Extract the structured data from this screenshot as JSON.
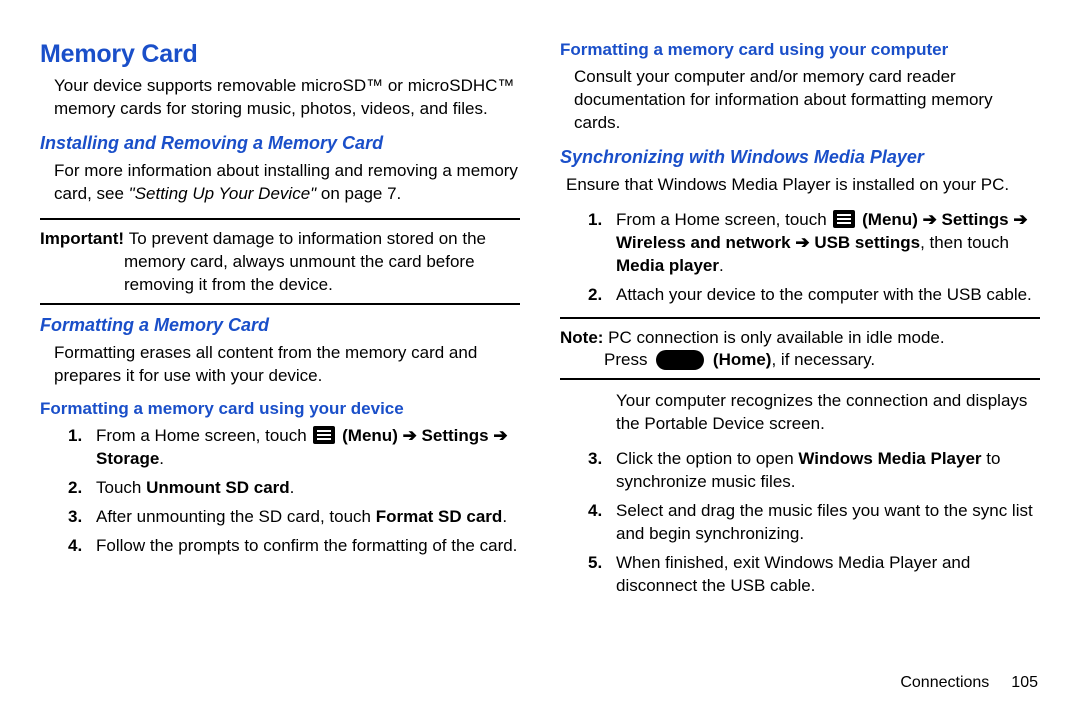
{
  "mainHeading": "Memory Card",
  "intro": "Your device supports removable microSD™ or microSDHC™ memory cards for storing music, photos, videos, and files.",
  "installHeading": "Installing and Removing a Memory Card",
  "installText1": "For more information about installing and removing a memory card, see ",
  "installRef": "\"Setting Up Your Device\"",
  "installText2": " on page 7.",
  "importantLabel": "Important! ",
  "importantText": "To prevent damage to information stored on the memory card, always unmount the card before removing it from the device.",
  "formatHeading": "Formatting a Memory Card",
  "formatIntro": "Formatting erases all content from the memory card and prepares it for use with your device.",
  "formatDeviceHeading": "Formatting a memory card using your device",
  "step1a": "From a Home screen, touch ",
  "step1b": " (Menu) ➔ Settings ➔ Storage",
  "step2a": "Touch ",
  "step2b": "Unmount SD card",
  "step3a": "After unmounting the SD card, touch ",
  "step3b": "Format SD card",
  "step4": "Follow the prompts to confirm the formatting of the card.",
  "formatPCHeading": "Formatting a memory card using your computer",
  "formatPCText": "Consult your computer and/or memory card reader documentation for information about formatting memory cards.",
  "syncHeading": "Synchronizing with Windows Media Player",
  "syncIntro": "Ensure that Windows Media Player is installed on your PC.",
  "sync1a": "From a Home screen, touch ",
  "sync1b": " (Menu) ➔ Settings ➔ Wireless and network ➔ USB settings",
  "sync1c": ", then touch ",
  "sync1d": "Media player",
  "sync2": "Attach your device to the computer with the USB cable.",
  "noteLabel": "Note: ",
  "noteLine1": "PC connection is only available in idle mode.",
  "noteLine2a": "Press ",
  "noteLine2b": " (Home)",
  "noteLine2c": ", if necessary.",
  "afterNote": "Your computer recognizes the connection and displays the Portable Device screen.",
  "sync3a": "Click the option to open ",
  "sync3b": "Windows Media Player",
  "sync3c": " to synchronize music files.",
  "sync4": "Select and drag the music files you want to the sync list and begin synchronizing.",
  "sync5": "When finished, exit Windows Media Player and disconnect the USB cable.",
  "footerSection": "Connections",
  "footerPage": "105"
}
